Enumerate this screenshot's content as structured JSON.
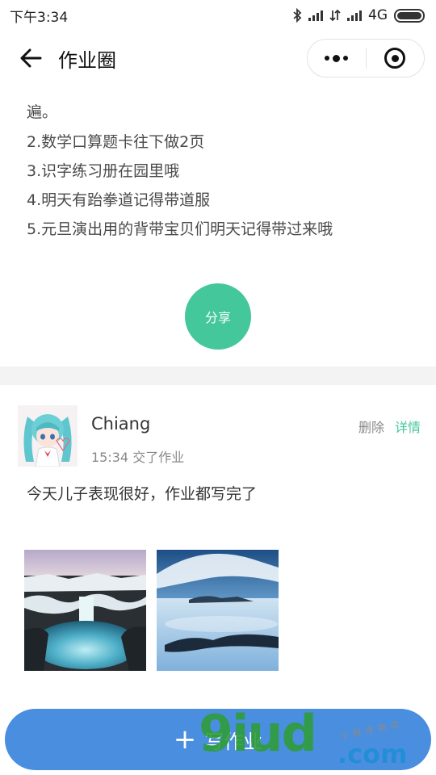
{
  "status_bar": {
    "time": "下午3:34",
    "network": "4G",
    "icons": [
      "bluetooth-icon",
      "signal-icon",
      "data-transfer-icon",
      "signal-icon",
      "battery-icon"
    ]
  },
  "nav": {
    "title": "作业圈",
    "back_icon": "arrow-left-icon",
    "menu_icon": "more-dots-icon",
    "close_icon": "target-circle-icon"
  },
  "first_post": {
    "lines": [
      "遍。",
      "2.数学口算题卡往下做2页",
      "3.识字练习册在园里哦",
      "4.明天有跆拳道记得带道服",
      "5.元旦演出用的背带宝贝们明天记得带过来哦"
    ],
    "share_label": "分享"
  },
  "second_post": {
    "user_name": "Chiang",
    "time_text": "15:34 交了作业",
    "delete_label": "删除",
    "detail_label": "详情",
    "content": "今天儿子表现很好，作业都写完了"
  },
  "bottom": {
    "write_label": "写作业",
    "plus_symbol": "+"
  },
  "watermark": {
    "main": "9iud",
    "domain": ".com",
    "sub": "小程序商店"
  },
  "colors": {
    "accent_green": "#43c79b",
    "button_blue": "#4a8ee0",
    "band_gray": "#f3f3f3"
  }
}
